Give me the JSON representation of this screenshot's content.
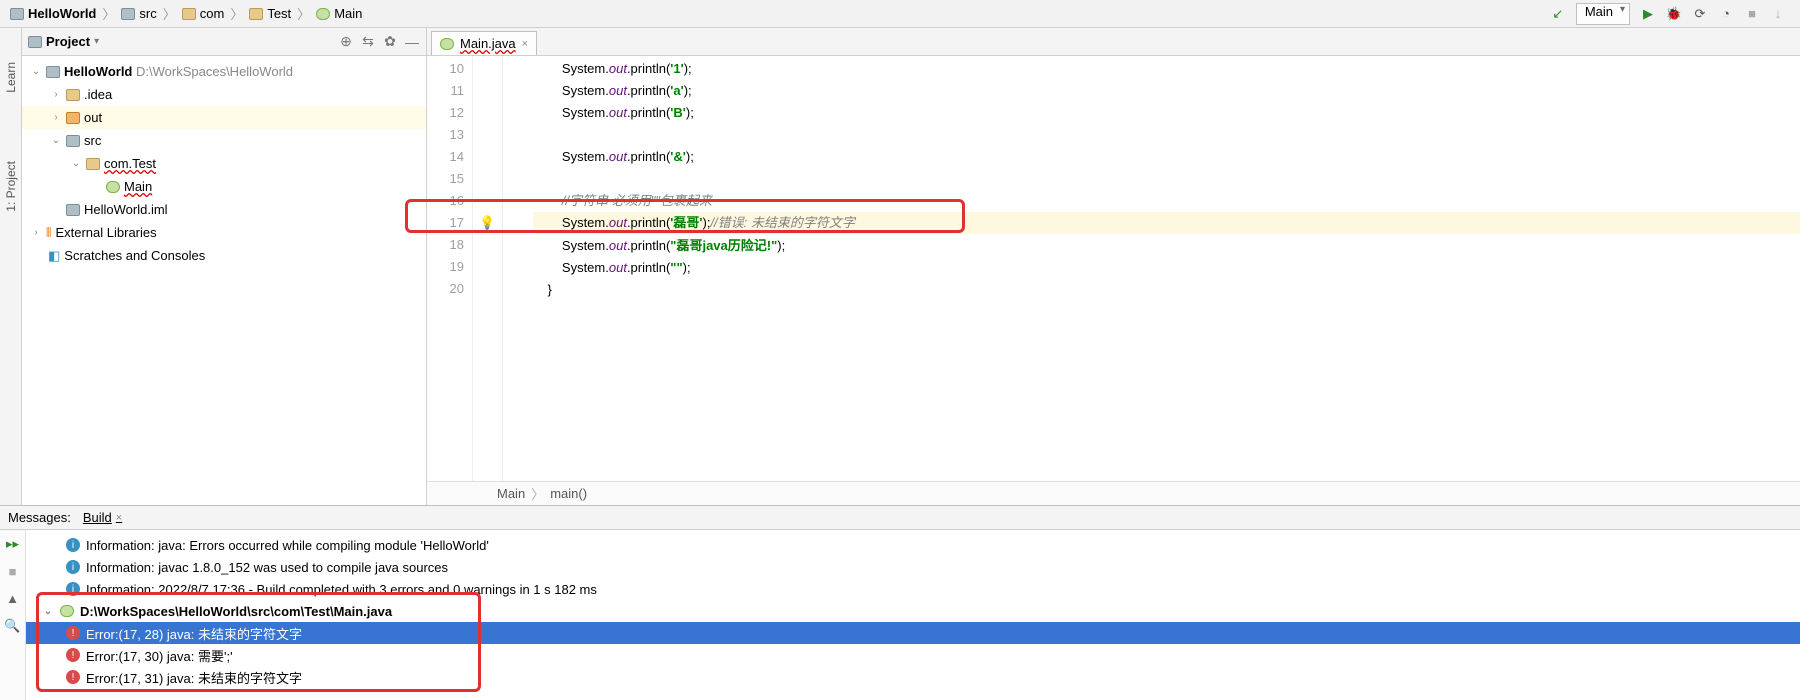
{
  "breadcrumbs": [
    "HelloWorld",
    "src",
    "com",
    "Test",
    "Main"
  ],
  "run_config": "Main",
  "left_rail": [
    "Learn",
    "1: Project"
  ],
  "project": {
    "title": "Project",
    "root": {
      "name": "HelloWorld",
      "path": "D:\\WorkSpaces\\HelloWorld"
    },
    "items": [
      {
        "indent": 1,
        "toggle": "›",
        "icon": "folder",
        "label": ".idea"
      },
      {
        "indent": 1,
        "toggle": "›",
        "icon": "folder-o",
        "label": "out",
        "sel": true
      },
      {
        "indent": 1,
        "toggle": "⌄",
        "icon": "mod",
        "label": "src"
      },
      {
        "indent": 2,
        "toggle": "⌄",
        "icon": "folder",
        "label": "com.Test",
        "wavy": true
      },
      {
        "indent": 3,
        "toggle": "",
        "icon": "class",
        "label": "Main",
        "wavy": true
      },
      {
        "indent": 1,
        "toggle": "",
        "icon": "mod",
        "label": "HelloWorld.iml"
      }
    ],
    "extlib": "External Libraries",
    "scratches": "Scratches and Consoles"
  },
  "editor": {
    "tab": "Main.java",
    "lines": [
      {
        "n": 10,
        "html": "        System.<span class='fld'>out</span>.println(<span class='str'>'1'</span>);"
      },
      {
        "n": 11,
        "html": "        System.<span class='fld'>out</span>.println(<span class='str'>'a'</span>);"
      },
      {
        "n": 12,
        "html": "        System.<span class='fld'>out</span>.println(<span class='str'>'B'</span>);"
      },
      {
        "n": 13,
        "html": ""
      },
      {
        "n": 14,
        "html": "        System.<span class='fld'>out</span>.println(<span class='str'>'&'</span>);"
      },
      {
        "n": 15,
        "html": ""
      },
      {
        "n": 16,
        "html": "        <span class='cmt'>//字符串 必须用\"\"包裹起来</span>"
      },
      {
        "n": 17,
        "html": "        System.<span class='fld'>out</span>.println(<span class='str'>'磊哥'</span>);<span class='cmt'>//错误: 未结束的字符文字</span>",
        "err": true,
        "bulb": true
      },
      {
        "n": 18,
        "html": "        System.<span class='fld'>out</span>.println(<span class='str'>\"磊哥java历险记!\"</span>);"
      },
      {
        "n": 19,
        "html": "        System.<span class='fld'>out</span>.println(<span class='str'>\"\"</span>);"
      },
      {
        "n": 20,
        "html": "    }"
      }
    ],
    "crumb": [
      "Main",
      "main()"
    ]
  },
  "messages": {
    "title": "Messages:",
    "tab": "Build",
    "rows": [
      {
        "lvl": "info",
        "indent": 1,
        "text": "Information: java: Errors occurred while compiling module 'HelloWorld'"
      },
      {
        "lvl": "info",
        "indent": 1,
        "text": "Information: javac 1.8.0_152 was used to compile java sources"
      },
      {
        "lvl": "info",
        "indent": 1,
        "text": "Information: 2022/8/7 17:36 - Build completed with 3 errors and 0 warnings in 1 s 182 ms"
      },
      {
        "lvl": "file",
        "indent": 0,
        "toggle": "⌄",
        "text": "D:\\WorkSpaces\\HelloWorld\\src\\com\\Test\\Main.java",
        "bold": true
      },
      {
        "lvl": "err",
        "indent": 1,
        "text": "Error:(17, 28)  java: 未结束的字符文字",
        "sel": true
      },
      {
        "lvl": "err",
        "indent": 1,
        "text": "Error:(17, 30)  java: 需要';'"
      },
      {
        "lvl": "err",
        "indent": 1,
        "text": "Error:(17, 31)  java: 未结束的字符文字"
      }
    ]
  },
  "colors": {
    "accent": "#3874d1",
    "err": "#e03030"
  }
}
